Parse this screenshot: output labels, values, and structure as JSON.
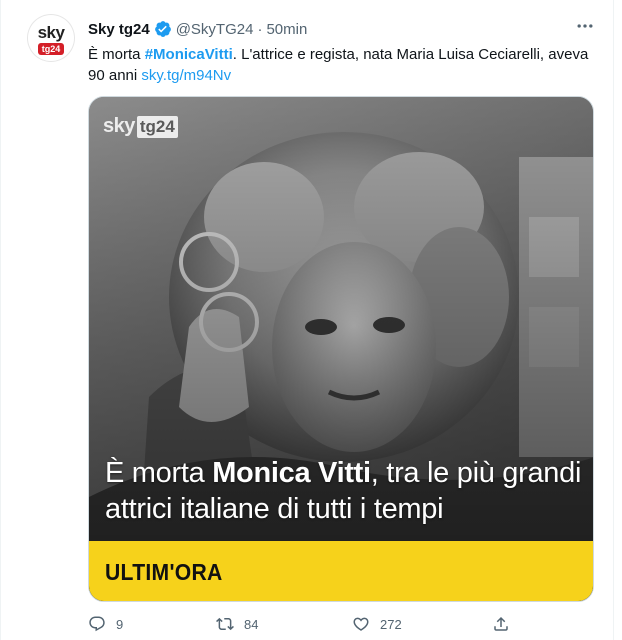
{
  "account": {
    "display_name": "Sky tg24",
    "handle": "@SkyTG24",
    "separator": "·",
    "time": "50min",
    "avatar_sky": "sky",
    "avatar_tg": "tg24"
  },
  "tweet": {
    "text_prefix": "È morta ",
    "hashtag": "#MonicaVitti",
    "text_suffix": ". L'attrice e regista, nata Maria Luisa Ceciarelli, aveva 90 anni ",
    "link": "sky.tg/m94Nv"
  },
  "media": {
    "watermark_sky": "sky",
    "watermark_tg": "tg24",
    "headline_prefix": "È morta ",
    "headline_bold": "Monica Vitti",
    "headline_suffix": ", tra le più grandi attrici italiane di tutti i tempi",
    "band_label": "ULTIM'ORA",
    "band_color": "#f6d21b"
  },
  "actions": {
    "replies": "9",
    "retweets": "84",
    "likes": "272"
  },
  "colors": {
    "link": "#1d9bf0",
    "verified": "#1d9bf0",
    "muted": "#536471",
    "brand_red": "#d41f28"
  }
}
